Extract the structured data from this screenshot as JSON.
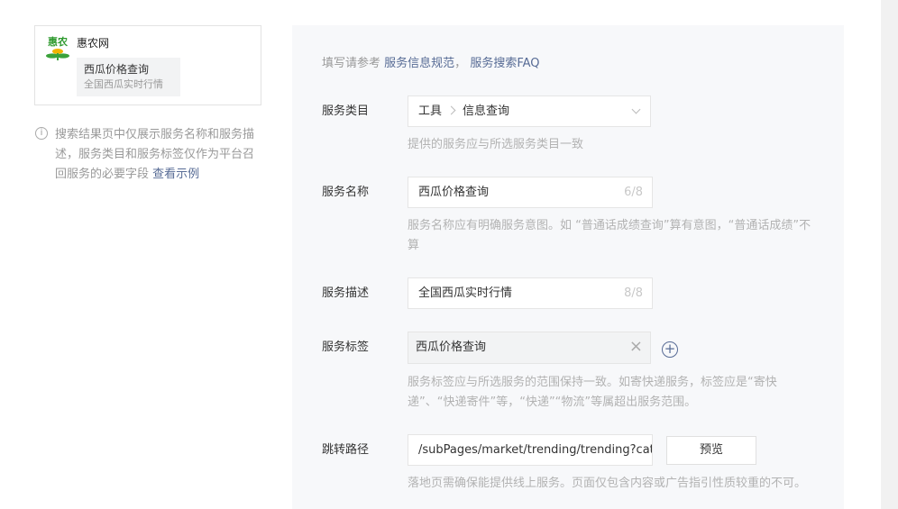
{
  "preview": {
    "logo_text": "惠农",
    "app_name": "惠农网",
    "service_name": "西瓜价格查询",
    "service_desc": "全国西瓜实时行情"
  },
  "note": {
    "text": "搜索结果页中仅展示服务名称和服务描述，服务类目和服务标签仅作为平台召回服务的必要字段",
    "link": "查看示例"
  },
  "form": {
    "ref_prefix": "填写请参考",
    "ref_link1": "服务信息规范",
    "ref_sep": "，",
    "ref_link2": "服务搜索FAQ",
    "category": {
      "label": "服务类目",
      "level1": "工具",
      "level2": "信息查询",
      "hint": "提供的服务应与所选服务类目一致"
    },
    "name": {
      "label": "服务名称",
      "value": "西瓜价格查询",
      "count": "6/8",
      "hint": "服务名称应有明确服务意图。如 “普通话成绩查询”算有意图，“普通话成绩”不算"
    },
    "desc": {
      "label": "服务描述",
      "value": "全国西瓜实时行情",
      "count": "8/8"
    },
    "tags": {
      "label": "服务标签",
      "value": "西瓜价格查询",
      "hint": "服务标签应与所选服务的范围保持一致。如寄快递服务，标签应是“寄快递”、“快递寄件”等，“快递”“物流”等属超出服务范围。"
    },
    "path": {
      "label": "跳转路径",
      "value": "/subPages/market/trending/trending?category",
      "preview_label": "预览",
      "hint": "落地页需确保能提供线上服务。页面仅包含内容或广告指引性质较重的不可。"
    }
  }
}
